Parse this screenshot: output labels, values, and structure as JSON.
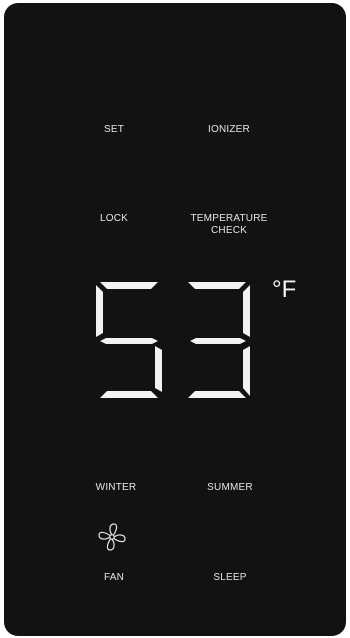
{
  "panel": {
    "background_color": "#121212",
    "label_color": "#e6e6e6"
  },
  "buttons": {
    "set": "SET",
    "ionizer": "IONIZER",
    "lock": "LOCK",
    "temperature_check_line1": "TEMPERATURE",
    "temperature_check_line2": "CHECK",
    "winter": "WINTER",
    "summer": "SUMMER",
    "fan": "FAN",
    "sleep": "SLEEP"
  },
  "display": {
    "temperature": "53",
    "unit": "°F",
    "segment_color": "#f2f2f2"
  },
  "icons": {
    "fan": "fan-icon"
  }
}
